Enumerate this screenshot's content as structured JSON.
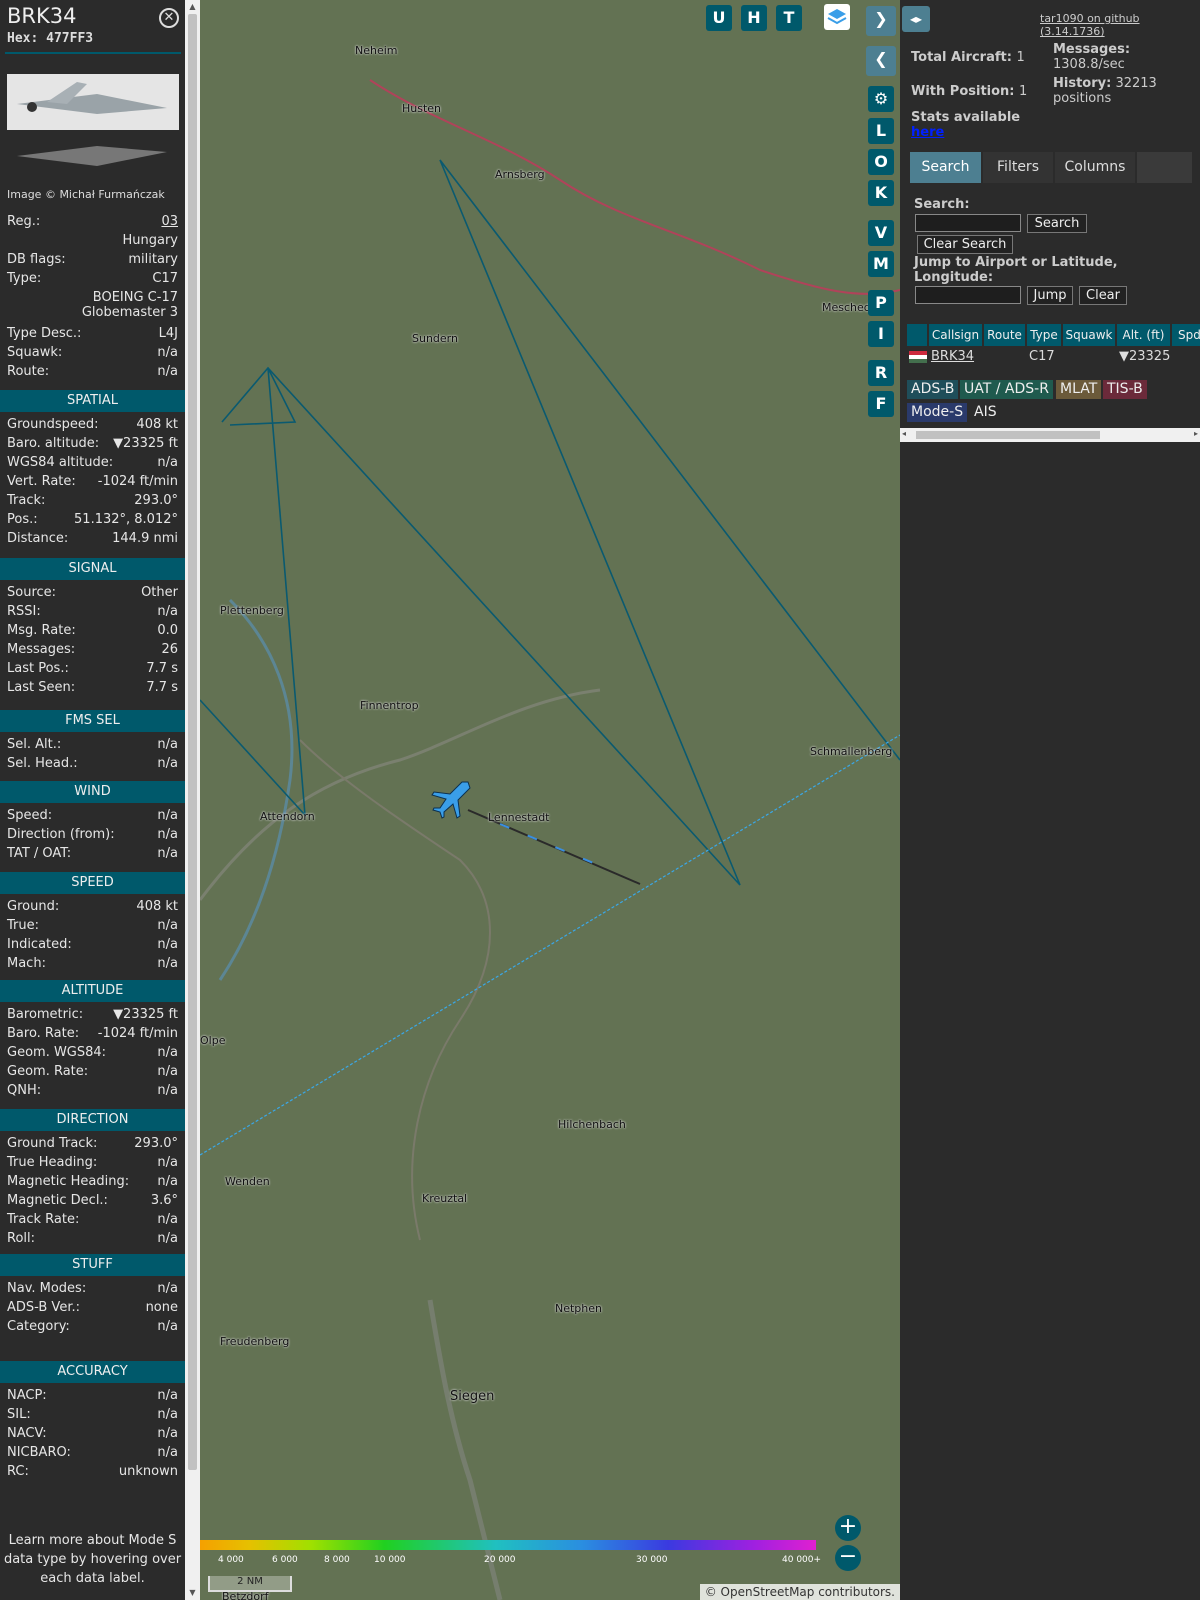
{
  "aircraft": {
    "callsign": "BRK34",
    "hex_label": "Hex:",
    "hex": "477FF3",
    "photo_credit": "Image © Michał Furmańczak"
  },
  "info": [
    {
      "label": "Reg.:",
      "value": "03"
    },
    {
      "label": "",
      "value": "Hungary"
    },
    {
      "label": "DB flags:",
      "value": "military"
    },
    {
      "label": "Type:",
      "value": "C17"
    },
    {
      "label": "",
      "value": "BOEING C-17"
    },
    {
      "label": "",
      "value": "Globemaster 3"
    },
    {
      "label": "Type Desc.:",
      "value": "L4J"
    },
    {
      "label": "Squawk:",
      "value": "n/a"
    },
    {
      "label": "Route:",
      "value": "n/a"
    }
  ],
  "sections": {
    "spatial": "SPATIAL",
    "signal": "SIGNAL",
    "fms": "FMS SEL",
    "wind": "WIND",
    "speed": "SPEED",
    "altitude": "ALTITUDE",
    "direction": "DIRECTION",
    "stuff": "STUFF",
    "accuracy": "ACCURACY"
  },
  "spatial": [
    {
      "label": "Groundspeed:",
      "value": "408 kt"
    },
    {
      "label": "Baro. altitude:",
      "value": "▼23325 ft"
    },
    {
      "label": "WGS84 altitude:",
      "value": "n/a"
    },
    {
      "label": "Vert. Rate:",
      "value": "-1024 ft/min"
    },
    {
      "label": "Track:",
      "value": "293.0°"
    },
    {
      "label": "Pos.:",
      "value": "51.132°, 8.012°"
    },
    {
      "label": "Distance:",
      "value": "144.9 nmi"
    }
  ],
  "signal": [
    {
      "label": "Source:",
      "value": "Other"
    },
    {
      "label": "RSSI:",
      "value": "n/a"
    },
    {
      "label": "Msg. Rate:",
      "value": "0.0"
    },
    {
      "label": "Messages:",
      "value": "26"
    },
    {
      "label": "Last Pos.:",
      "value": "7.7 s"
    },
    {
      "label": "Last Seen:",
      "value": "7.7 s"
    }
  ],
  "fms": [
    {
      "label": "Sel. Alt.:",
      "value": "n/a"
    },
    {
      "label": "Sel. Head.:",
      "value": "n/a"
    }
  ],
  "wind": [
    {
      "label": "Speed:",
      "value": "n/a"
    },
    {
      "label": "Direction (from):",
      "value": "n/a"
    },
    {
      "label": "TAT / OAT:",
      "value": "n/a"
    }
  ],
  "speed": [
    {
      "label": "Ground:",
      "value": "408 kt"
    },
    {
      "label": "True:",
      "value": "n/a"
    },
    {
      "label": "Indicated:",
      "value": "n/a"
    },
    {
      "label": "Mach:",
      "value": "n/a"
    }
  ],
  "altitude": [
    {
      "label": "Barometric:",
      "value": "▼23325 ft"
    },
    {
      "label": "Baro. Rate:",
      "value": "-1024 ft/min"
    },
    {
      "label": "Geom. WGS84:",
      "value": "n/a"
    },
    {
      "label": "Geom. Rate:",
      "value": "n/a"
    },
    {
      "label": "QNH:",
      "value": "n/a"
    }
  ],
  "direction": [
    {
      "label": "Ground Track:",
      "value": "293.0°"
    },
    {
      "label": "True Heading:",
      "value": "n/a"
    },
    {
      "label": "Magnetic Heading:",
      "value": "n/a"
    },
    {
      "label": "Magnetic Decl.:",
      "value": "3.6°"
    },
    {
      "label": "Track Rate:",
      "value": "n/a"
    },
    {
      "label": "Roll:",
      "value": "n/a"
    }
  ],
  "stuff": [
    {
      "label": "Nav. Modes:",
      "value": "n/a"
    },
    {
      "label": "ADS-B Ver.:",
      "value": "none"
    },
    {
      "label": "Category:",
      "value": "n/a"
    }
  ],
  "accuracy": [
    {
      "label": "NACP:",
      "value": "n/a"
    },
    {
      "label": "SIL:",
      "value": "n/a"
    },
    {
      "label": "NACV:",
      "value": "n/a"
    },
    {
      "label": "NICBARO:",
      "value": "n/a"
    },
    {
      "label": "RC:",
      "value": "unknown"
    }
  ],
  "learn_more": "Learn more about Mode S data type by hovering over each data label.",
  "map": {
    "buttons_top": [
      "U",
      "H",
      "T"
    ],
    "buttons_side": [
      "L",
      "O",
      "K",
      "V",
      "M",
      "P",
      "I",
      "R",
      "F"
    ],
    "towns": [
      {
        "name": "Neheim"
      },
      {
        "name": "Husten"
      },
      {
        "name": "Arnsberg"
      },
      {
        "name": "Sundern"
      },
      {
        "name": "Meschede"
      },
      {
        "name": "Plettenberg"
      },
      {
        "name": "Finnentrop"
      },
      {
        "name": "Attendorn"
      },
      {
        "name": "Lennestadt"
      },
      {
        "name": "Schmallenberg"
      },
      {
        "name": "Hilchenbach"
      },
      {
        "name": "Wenden"
      },
      {
        "name": "Kreuztal"
      },
      {
        "name": "Netphen"
      },
      {
        "name": "Freudenberg"
      },
      {
        "name": "Siegen"
      },
      {
        "name": "Betzdorf"
      },
      {
        "name": "Olpe"
      }
    ],
    "colorbar_labels": [
      "4 000",
      "6 000",
      "8 000",
      "10 000",
      "20 000",
      "30 000",
      "40 000+"
    ],
    "scale": "2 NM",
    "attribution": "© OpenStreetMap contributors.",
    "zoom_in": "+",
    "zoom_out": "−"
  },
  "right": {
    "github": "tar1090 on github (3.14.1736)",
    "total_aircraft_label": "Total Aircraft:",
    "total_aircraft": "1",
    "with_position_label": "With Position:",
    "with_position": "1",
    "messages_label": "Messages:",
    "messages": "1308.8/sec",
    "history_label": "History:",
    "history": "32213 positions",
    "stats_label": "Stats available",
    "stats_link": "here",
    "tabs": [
      "Search",
      "Filters",
      "Columns"
    ],
    "search_label": "Search:",
    "search_btn": "Search",
    "clear_search": "Clear Search",
    "jump_label": "Jump to Airport or Latitude, Longitude:",
    "jump_btn": "Jump",
    "clear_btn": "Clear",
    "columns": [
      "",
      "Callsign",
      "Route",
      "Type",
      "Squawk",
      "Alt. (ft)",
      "Spd"
    ],
    "row": {
      "callsign": "BRK34",
      "route": "",
      "type": "C17",
      "squawk": "",
      "alt": "▼23325"
    },
    "sources": [
      "ADS-B",
      "UAT / ADS-R",
      "MLAT",
      "TIS-B",
      "Mode-S",
      "AIS"
    ],
    "source_colors": [
      "#1f4e5a",
      "#1f5a4e",
      "#6b5a3a",
      "#6b2a3a",
      "#2a3a6b",
      ""
    ]
  }
}
